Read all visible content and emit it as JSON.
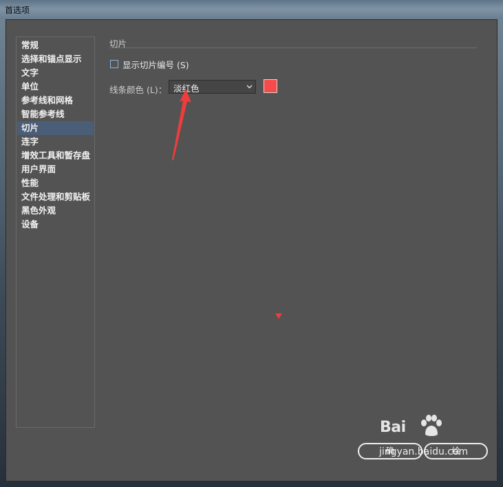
{
  "window": {
    "title": "首选项"
  },
  "sidebar": {
    "items": [
      {
        "label": "常规",
        "selected": false
      },
      {
        "label": "选择和锚点显示",
        "selected": false
      },
      {
        "label": "文字",
        "selected": false
      },
      {
        "label": "单位",
        "selected": false
      },
      {
        "label": "参考线和网格",
        "selected": false
      },
      {
        "label": "智能参考线",
        "selected": false
      },
      {
        "label": "切片",
        "selected": true
      },
      {
        "label": "连字",
        "selected": false
      },
      {
        "label": "增效工具和暂存盘",
        "selected": false
      },
      {
        "label": "用户界面",
        "selected": false
      },
      {
        "label": "性能",
        "selected": false
      },
      {
        "label": "文件处理和剪贴板",
        "selected": false
      },
      {
        "label": "黑色外观",
        "selected": false
      },
      {
        "label": "设备",
        "selected": false
      }
    ]
  },
  "main": {
    "section_title": "切片",
    "show_slice_numbers": {
      "label": "显示切片编号 (S)",
      "checked": false
    },
    "line_color": {
      "label": "线条颜色 (L)：",
      "value": "淡红色",
      "swatch_color": "#f64b4b"
    }
  },
  "buttons": {
    "ok": "确",
    "cancel": "绘"
  },
  "watermark": {
    "brand": "Bai",
    "url": "jingyan.baidu.com"
  },
  "colors": {
    "dialog_bg": "#535353",
    "selected_item": "#4a5e78",
    "annotation_red": "#f03c3c"
  }
}
